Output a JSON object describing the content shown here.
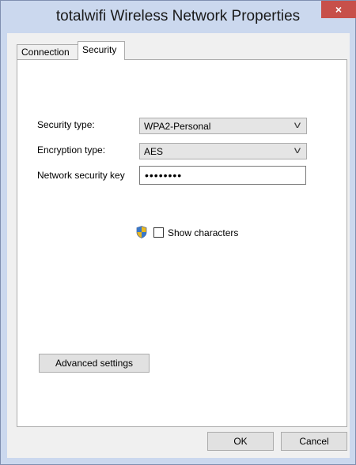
{
  "window": {
    "title": "totalwifi Wireless Network Properties",
    "close_glyph": "×"
  },
  "tabs": [
    {
      "label": "Connection",
      "active": false
    },
    {
      "label": "Security",
      "active": true
    }
  ],
  "security": {
    "security_type_label": "Security type:",
    "security_type_value": "WPA2-Personal",
    "encryption_type_label": "Encryption type:",
    "encryption_type_value": "AES",
    "network_key_label": "Network security key",
    "network_key_masked": "••••••••",
    "show_characters_label": "Show characters",
    "show_characters_checked": false,
    "dropdown_glyph": "v"
  },
  "buttons": {
    "advanced_settings": "Advanced settings",
    "ok": "OK",
    "cancel": "Cancel"
  },
  "icons": {
    "shield": "uac-shield-icon",
    "close": "close-icon",
    "dropdown": "chevron-down-icon"
  },
  "colors": {
    "frame": "#cbd8ee",
    "close_button": "#c7504a",
    "panel": "#ffffff"
  }
}
